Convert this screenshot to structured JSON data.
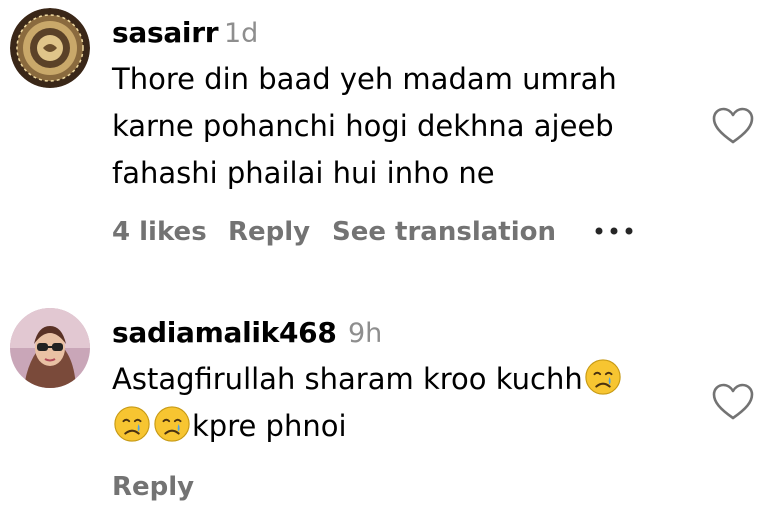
{
  "comments": [
    {
      "username": "sasairr",
      "time": "1d",
      "text_lines": [
        "Thore din baad yeh madam umrah",
        "karne pohanchi hogi dekhna ajeeb",
        "fahashi phailai hui inho ne"
      ],
      "likes": "4 likes",
      "reply": "Reply",
      "translate": "See translation"
    },
    {
      "username": "sadiamalik468",
      "time": "9h",
      "line1_text": "Astagfirullah sharam kroo kuchh",
      "line2_text": "kpre phnoi",
      "reply": "Reply"
    }
  ],
  "icons": {
    "like": "heart-outline-icon",
    "more": "more-horizontal-icon",
    "emoji": "crying-face-emoji"
  },
  "colors": {
    "meta_text": "#737373",
    "time_text": "#8e8e8e",
    "emoji_face": "#f7c531",
    "tear": "#4aa3e6"
  }
}
